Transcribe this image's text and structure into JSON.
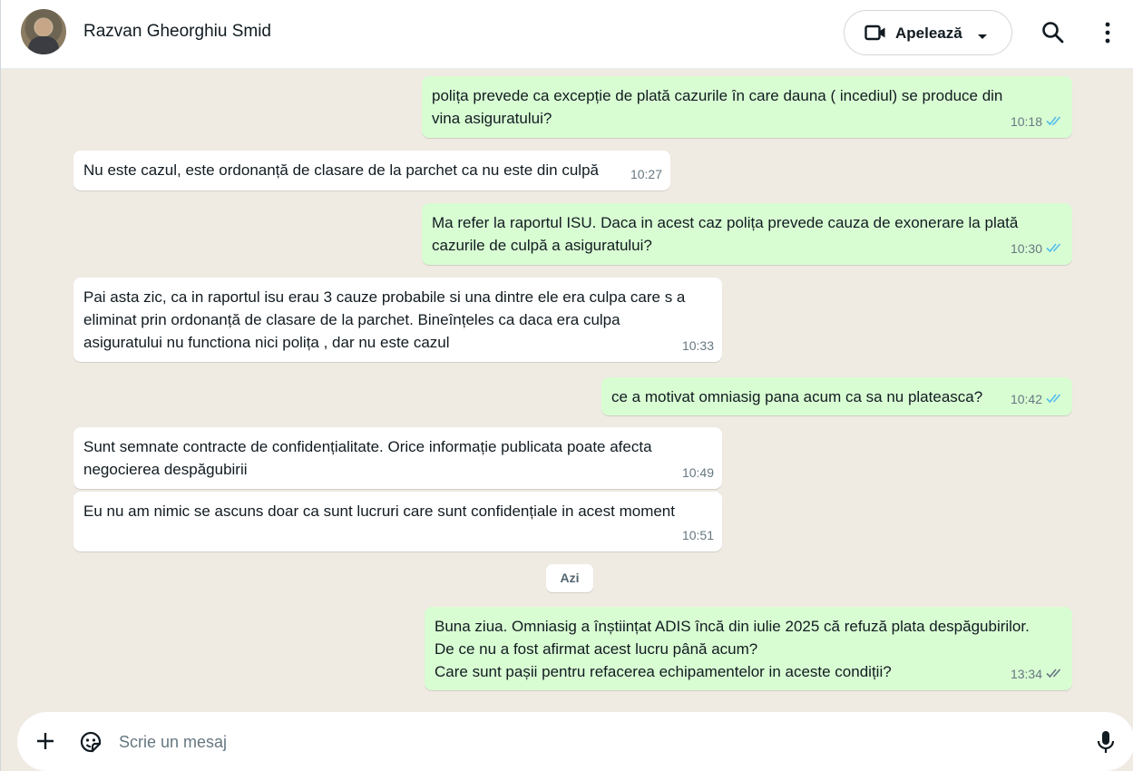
{
  "header": {
    "contact_name": "Razvan Gheorghiu Smid",
    "call_label": "Apelează",
    "icons": [
      "video-icon",
      "chevron-down-icon",
      "search-icon",
      "more-vertical-icon"
    ]
  },
  "messages": [
    {
      "direction": "out",
      "text": "polița prevede ca excepție de plată cazurile în care dauna ( incediul) se produce din\nvina asiguratului?",
      "time": "10:18",
      "status": "read"
    },
    {
      "direction": "in",
      "text": "Nu este cazul, este ordonanță de clasare de la parchet ca nu este din culpă",
      "time": "10:27"
    },
    {
      "direction": "out",
      "text": "Ma refer la raportul ISU. Daca in acest caz polița prevede cauza de exonerare la plată\ncazurile de culpă a asiguratului?",
      "time": "10:30",
      "status": "read"
    },
    {
      "direction": "in",
      "text": "Pai asta zic, ca in raportul isu erau 3 cauze probabile si una dintre ele era culpa care s a\neliminat prin ordonanță de clasare de la parchet. Bineînțeles ca daca era culpa\nasiguratului nu functiona nici polița , dar nu este cazul",
      "time": "10:33"
    },
    {
      "direction": "out",
      "text": "ce a motivat omniasig pana acum ca sa nu plateasca?",
      "time": "10:42",
      "status": "read"
    },
    {
      "direction": "in",
      "text": "Sunt semnate contracte de confidențialitate. Orice informație publicata poate afecta\nnegocierea despăgubirii",
      "time": "10:49"
    },
    {
      "direction": "in",
      "text": "Eu nu am nimic se ascuns doar ca sunt lucruri care sunt confidențiale in acest moment",
      "time": "10:51"
    },
    {
      "direction": "out",
      "text": "Buna ziua. Omniasig a înștiințat ADIS încă din iulie 2025 că refuză plata despăgubirilor.\nDe ce nu a fost afirmat acest lucru până acum?\nCare sunt pașii pentru refacerea echipamentelor in aceste condiții?",
      "time": "13:34",
      "status": "delivered"
    }
  ],
  "day_separator": "Azi",
  "composer": {
    "placeholder": "Scrie un mesaj",
    "icons": [
      "plus-icon",
      "sticker-icon",
      "mic-icon"
    ]
  },
  "colors": {
    "outgoing_bubble": "#d9fdd3",
    "incoming_bubble": "#ffffff",
    "chat_background": "#efeae2",
    "read_ticks": "#53bdeb",
    "delivered_ticks": "#667781"
  }
}
